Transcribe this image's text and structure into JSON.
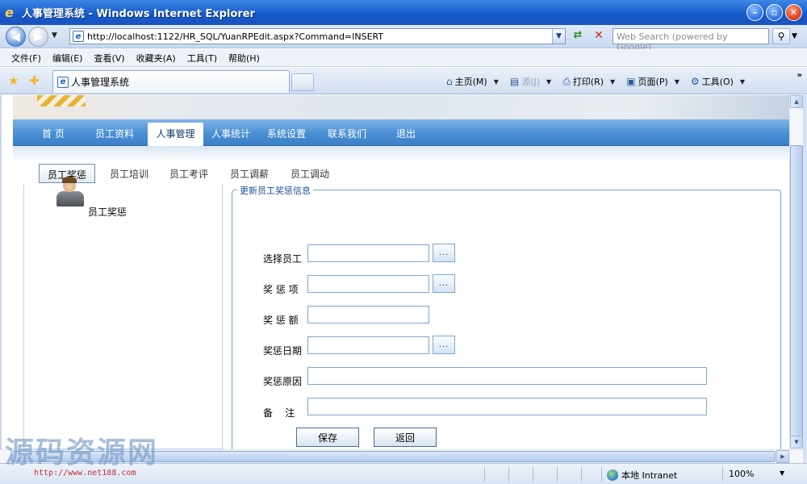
{
  "window": {
    "title": "人事管理系统 - Windows Internet Explorer",
    "ie_glyph": "e"
  },
  "address_bar": {
    "url": "http://localhost:1122/HR_SQL/YuanRPEdit.aspx?Command=INSERT",
    "search_placeholder": "Web Search (powered by Google)"
  },
  "menu": {
    "items": [
      "文件(F)",
      "编辑(E)",
      "查看(V)",
      "收藏夹(A)",
      "工具(T)",
      "帮助(H)"
    ]
  },
  "tabs": {
    "active_title": "人事管理系统"
  },
  "command_bar": {
    "home": "主页(M)",
    "feeds": "源(J)",
    "print": "打印(R)",
    "page": "页面(P)",
    "tools": "工具(O)"
  },
  "site_nav": {
    "items": [
      "首 页",
      "员工资料",
      "人事管理",
      "人事统计",
      "系统设置",
      "联系我们",
      "退出"
    ],
    "active": "人事管理"
  },
  "sub_tabs": {
    "items": [
      "员工奖惩",
      "员工培训",
      "员工考评",
      "员工调薪",
      "员工调动"
    ],
    "active": "员工奖惩"
  },
  "left_panel": {
    "label": "员工奖惩"
  },
  "form": {
    "legend": "更新员工奖惩信息",
    "fields": [
      {
        "label": "选择员工",
        "value": ""
      },
      {
        "label": "奖 惩 项",
        "value": ""
      },
      {
        "label": "奖 惩 额",
        "value": ""
      },
      {
        "label": "奖惩日期",
        "value": ""
      },
      {
        "label": "奖惩原因",
        "value": ""
      },
      {
        "label": "备    注",
        "value": ""
      }
    ],
    "picker_label": "...",
    "save_label": "保存",
    "back_label": "返回"
  },
  "status_bar": {
    "zone": "本地 Intranet",
    "zoom": "100%"
  },
  "watermark": {
    "text": "源码资源网",
    "url": "http://www.net188.com"
  },
  "colors": {
    "titlebar": "#1658c9",
    "nav_blue": "#4a8fd4",
    "input_border": "#7fa5cf",
    "legend_text": "#1d4f9a"
  }
}
